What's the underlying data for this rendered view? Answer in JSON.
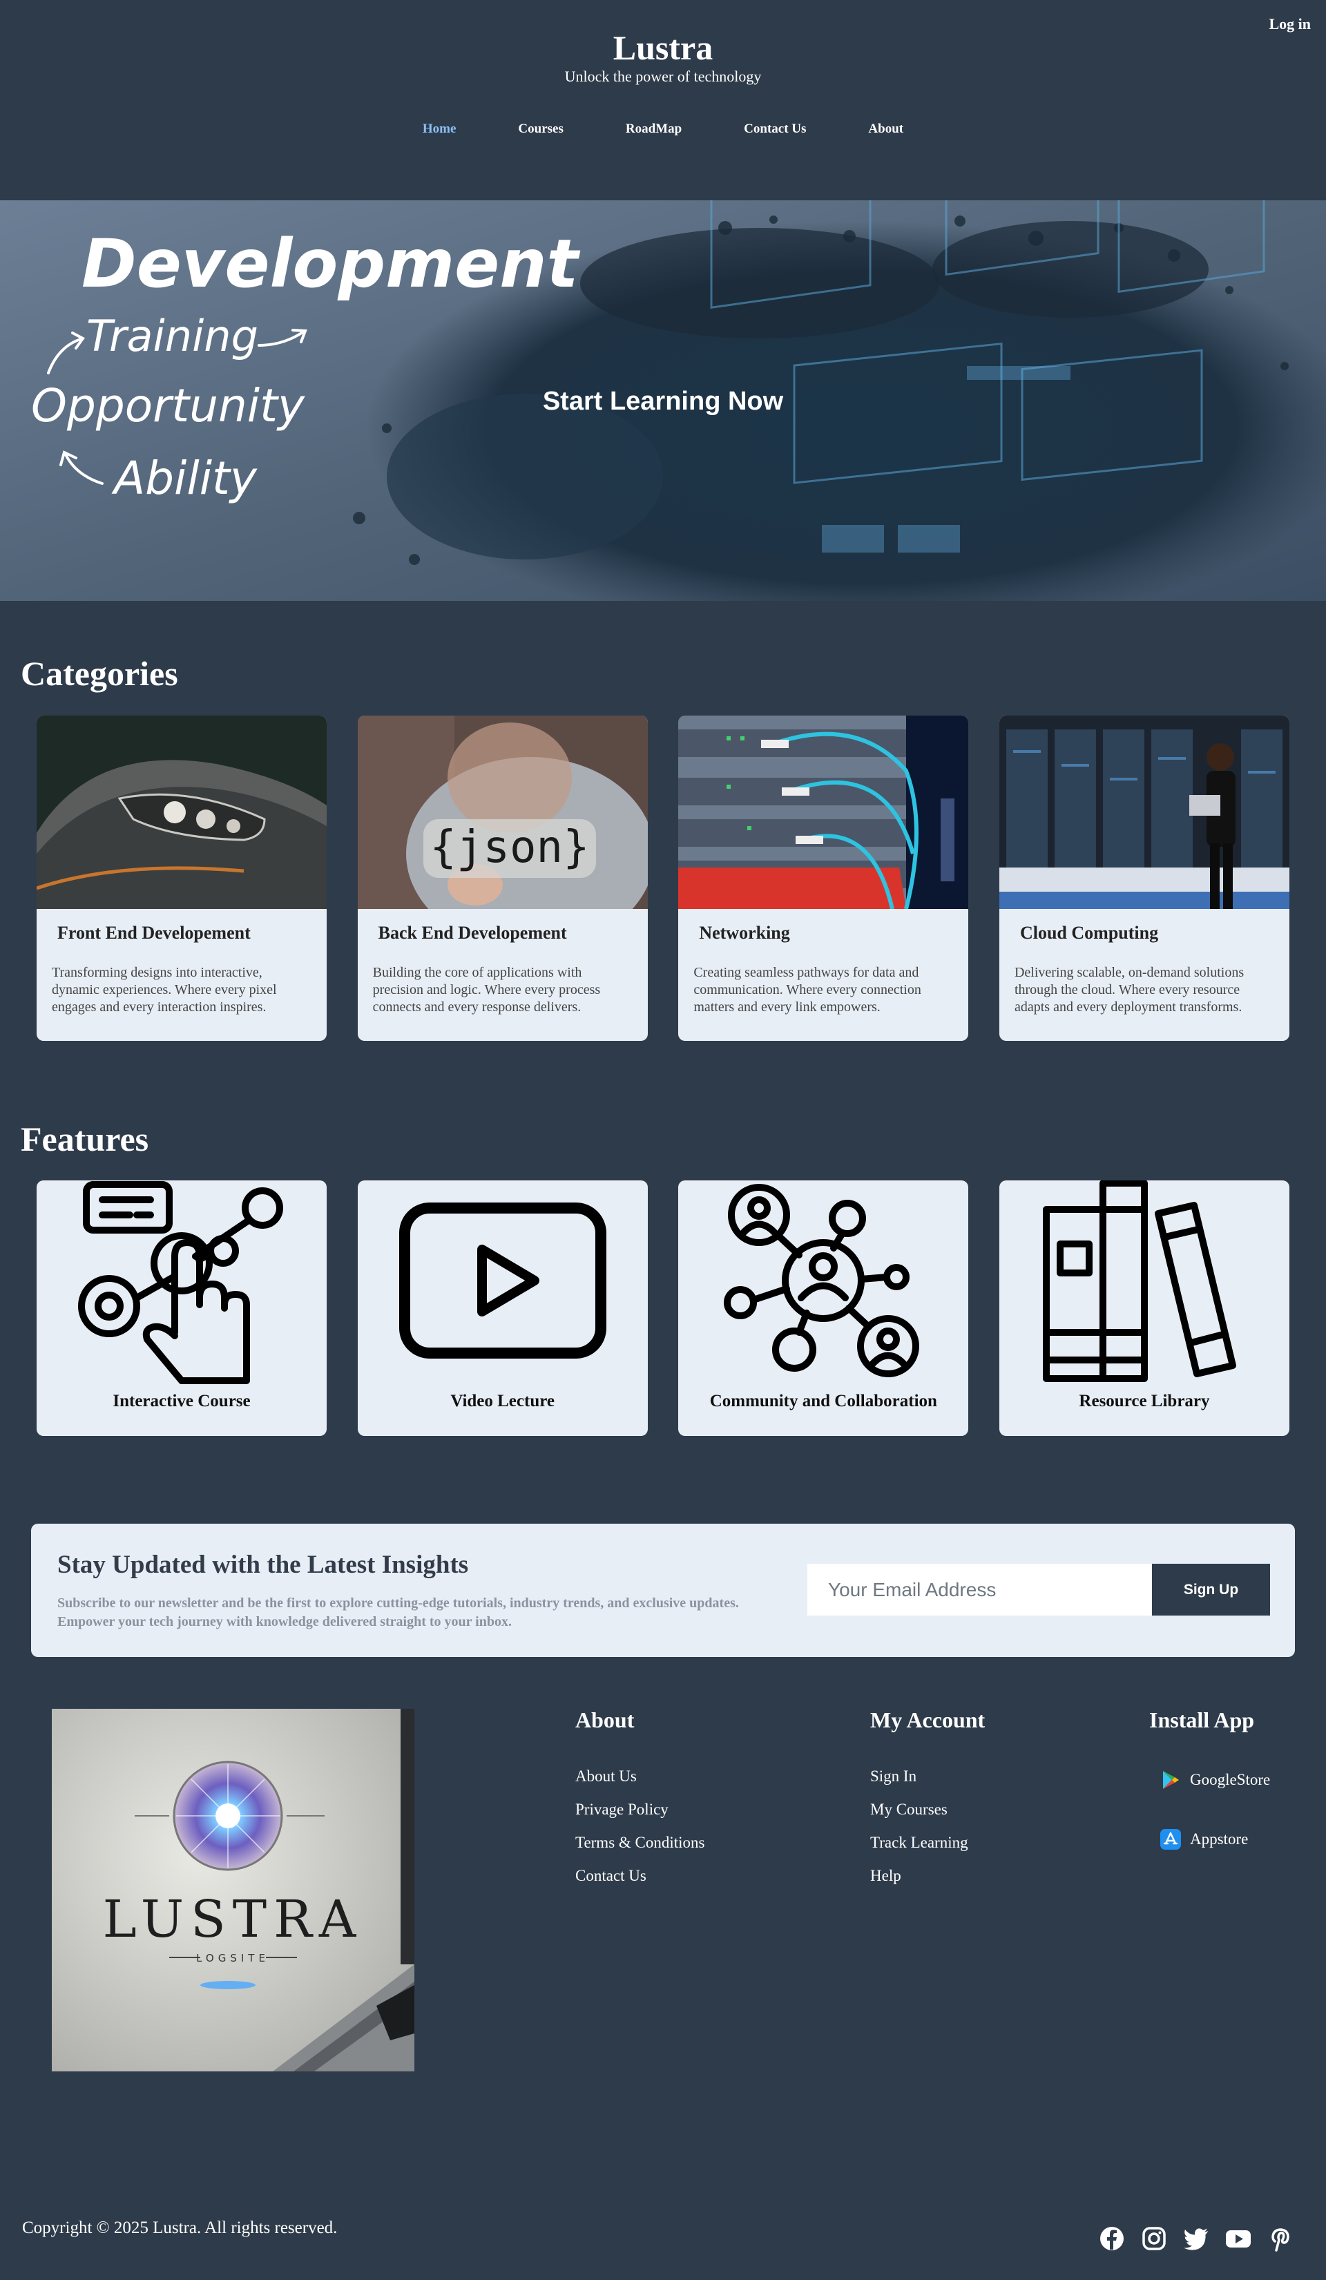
{
  "header": {
    "login": "Log in",
    "brand": "Lustra",
    "tagline": "Unlock the power of technology",
    "nav": [
      "Home",
      "Courses",
      "RoadMap",
      "Contact Us",
      "About"
    ]
  },
  "hero": {
    "words": [
      "Development",
      "Training",
      "Opportunity",
      "Ability"
    ],
    "cta": "Start Learning Now"
  },
  "categories": {
    "title": "Categories",
    "items": [
      {
        "title": "Front End Developement",
        "desc": "Transforming designs into interactive, dynamic experiences. Where every pixel engages and every interaction inspires."
      },
      {
        "title": "Back End Developement",
        "desc": "Building the core of applications with precision and logic. Where every process connects and every response delivers."
      },
      {
        "title": "Networking",
        "desc": "Creating seamless pathways for data and communication. Where every connection matters and every link empowers."
      },
      {
        "title": "Cloud Computing",
        "desc": "Delivering scalable, on-demand solutions through the cloud. Where every resource adapts and every deployment transforms."
      }
    ],
    "json_label": "{json}"
  },
  "features": {
    "title": "Features",
    "items": [
      "Interactive Course",
      "Video Lecture",
      "Community and Collaboration",
      "Resource Library"
    ]
  },
  "newsletter": {
    "title": "Stay Updated with the Latest Insights",
    "text": "Subscribe to our newsletter and be the first to explore cutting-edge tutorials, industry trends, and exclusive updates. Empower your tech journey with knowledge delivered straight to your inbox.",
    "placeholder": "Your Email Address",
    "button": "Sign Up"
  },
  "footer": {
    "logo_text": "LUSTRA",
    "logo_sub": "LOGSITE",
    "about": {
      "title": "About",
      "links": [
        "About Us",
        "Privage Policy",
        "Terms & Conditions",
        "Contact Us"
      ]
    },
    "account": {
      "title": "My Account",
      "links": [
        "Sign In",
        "My Courses",
        "Track Learning",
        "Help"
      ]
    },
    "install": {
      "title": "Install App",
      "links": [
        "GoogleStore",
        "Appstore"
      ]
    },
    "copyright": "Copyright © 2025 Lustra. All rights reserved.",
    "socials": [
      "facebook-icon",
      "instagram-icon",
      "twitter-icon",
      "youtube-icon",
      "pinterest-icon"
    ]
  },
  "colors": {
    "background": "#2e3b4a",
    "card": "#e8eef6",
    "nav_active": "#8cc1f5"
  }
}
